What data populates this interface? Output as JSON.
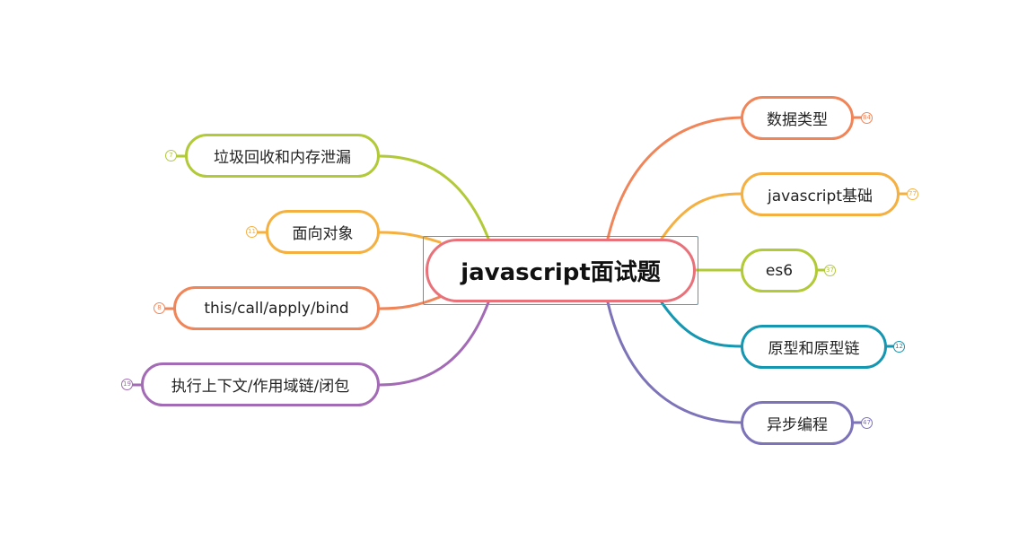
{
  "root": {
    "label": "javascript面试题",
    "border_color": "#e8717a",
    "selection_color": "#29a8e0"
  },
  "right_branches": [
    {
      "label": "数据类型",
      "count": "84",
      "color": "#f0855a"
    },
    {
      "label": "javascript基础",
      "count": "77",
      "color": "#f5b042"
    },
    {
      "label": "es6",
      "count": "37",
      "color": "#b2c938"
    },
    {
      "label": "原型和原型链",
      "count": "12",
      "color": "#1596b1"
    },
    {
      "label": "异步编程",
      "count": "47",
      "color": "#7d73b9"
    }
  ],
  "left_branches": [
    {
      "label": "垃圾回收和内存泄漏",
      "count": "7",
      "color": "#b2c938"
    },
    {
      "label": "面向对象",
      "count": "11",
      "color": "#f5b042"
    },
    {
      "label": "this/call/apply/bind",
      "count": "8",
      "color": "#f0855a"
    },
    {
      "label": "执行上下文/作用域链/闭包",
      "count": "19",
      "color": "#a36bb5"
    }
  ]
}
